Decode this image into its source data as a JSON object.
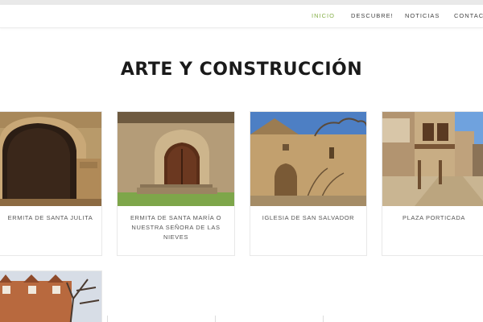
{
  "nav": {
    "items": [
      "INICIO",
      "DESCUBRE!",
      "NOTICIAS",
      "CONTACTO"
    ],
    "active_color": "#86b04a"
  },
  "section": {
    "title": "ARTE Y CONSTRUCCIÓN"
  },
  "cards": [
    {
      "label": "ERMITA DE SANTA JULITA",
      "image": "stone-arch-doorway"
    },
    {
      "label": "ERMITA DE SANTA MARÍA O NUESTRA SEÑORA DE LAS NIEVES",
      "image": "chapel-wooden-door"
    },
    {
      "label": "IGLESIA DE SAN SALVADOR",
      "image": "stone-church-tree"
    },
    {
      "label": "PLAZA PORTICADA",
      "image": "arcaded-street"
    },
    {
      "label": "",
      "image": "brick-house-tree"
    }
  ]
}
